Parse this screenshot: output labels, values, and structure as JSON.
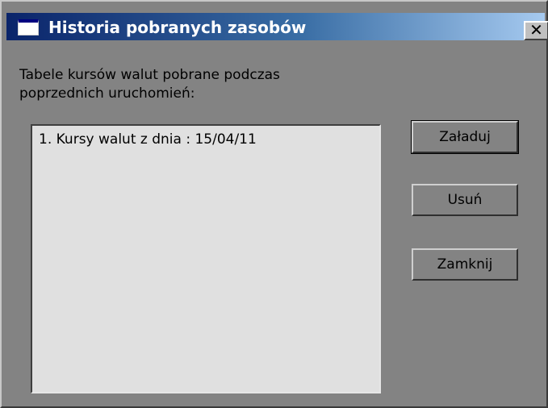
{
  "window": {
    "title": "Historia pobranych zasobów",
    "close_label": "✕"
  },
  "instruction": "Tabele kursów walut pobrane podczas poprzednich uruchomień:",
  "list": {
    "items": [
      "1. Kursy walut z dnia : 15/04/11"
    ]
  },
  "buttons": {
    "load": "Załaduj",
    "delete": "Usuń",
    "close": "Zamknij"
  },
  "colors": {
    "titlebar_start": "#0a246a",
    "titlebar_end": "#a6caf0",
    "dialog_bg": "#838383",
    "list_bg": "#e0e0e0"
  }
}
